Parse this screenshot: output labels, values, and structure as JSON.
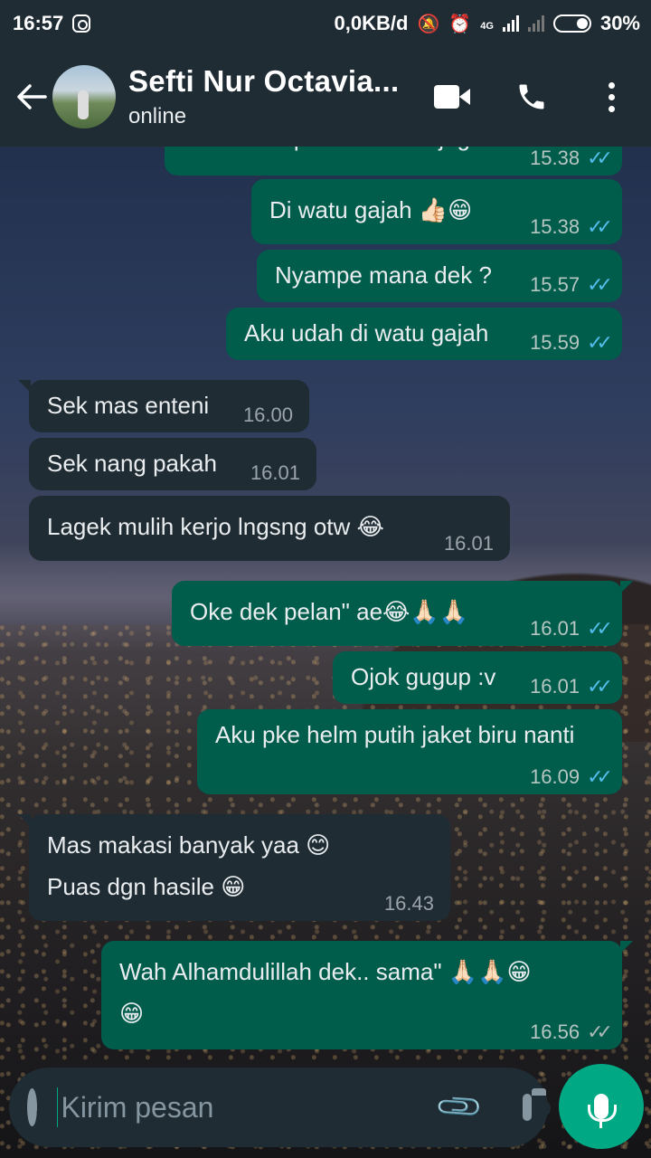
{
  "statusbar": {
    "time": "16:57",
    "net_speed": "0,0KB/d",
    "network_type": "4G",
    "battery": "30%",
    "icons": [
      "instagram-icon",
      "mute-icon",
      "alarm-icon",
      "signal-icon",
      "battery-icon"
    ]
  },
  "header": {
    "contact_name": "Sefti Nur Octavia...",
    "status": "online",
    "icons": [
      "back-arrow-icon",
      "video-call-icon",
      "phone-icon",
      "more-icon"
    ]
  },
  "messages": [
    {
      "dir": "out",
      "text": "Ok dek siap aku tak otw juga",
      "time": "15.38",
      "read": true
    },
    {
      "dir": "out",
      "text": "Di watu gajah 👍🏻😁",
      "time": "15.38",
      "read": true
    },
    {
      "dir": "out",
      "text": "Nyampe mana dek ?",
      "time": "15.57",
      "read": true
    },
    {
      "dir": "out",
      "text": "Aku udah di watu gajah",
      "time": "15.59",
      "read": true
    },
    {
      "dir": "in",
      "text": "Sek mas enteni",
      "time": "16.00"
    },
    {
      "dir": "in",
      "text": "Sek nang pakah",
      "time": "16.01"
    },
    {
      "dir": "in",
      "text": "Lagek mulih kerjo lngsng otw 😂",
      "time": "16.01"
    },
    {
      "dir": "out",
      "text": "Oke dek pelan\" ae😂🙏🏻🙏🏻",
      "time": "16.01",
      "read": true
    },
    {
      "dir": "out",
      "text": "Ojok gugup :v",
      "time": "16.01",
      "read": true
    },
    {
      "dir": "out",
      "text": "Aku pke helm putih jaket biru nanti",
      "time": "16.09",
      "read": true
    },
    {
      "dir": "in",
      "text": "Mas makasi banyak yaa 😊",
      "text2": "Puas dgn hasile 😁",
      "time": "16.43"
    },
    {
      "dir": "out",
      "text": "Wah Alhamdulillah dek.. sama\" 🙏🏻🙏🏻😁",
      "text2": "😁",
      "time": "16.56",
      "read": false
    }
  ],
  "composer": {
    "placeholder": "Kirim pesan",
    "icons": [
      "emoji-icon",
      "attach-icon",
      "camera-icon",
      "mic-icon"
    ]
  },
  "colors": {
    "outgoing_bubble": "#005c4b",
    "incoming_bubble": "#202c33",
    "header": "#1f2c34",
    "accent": "#00a884",
    "read_ticks": "#53bdeb"
  }
}
